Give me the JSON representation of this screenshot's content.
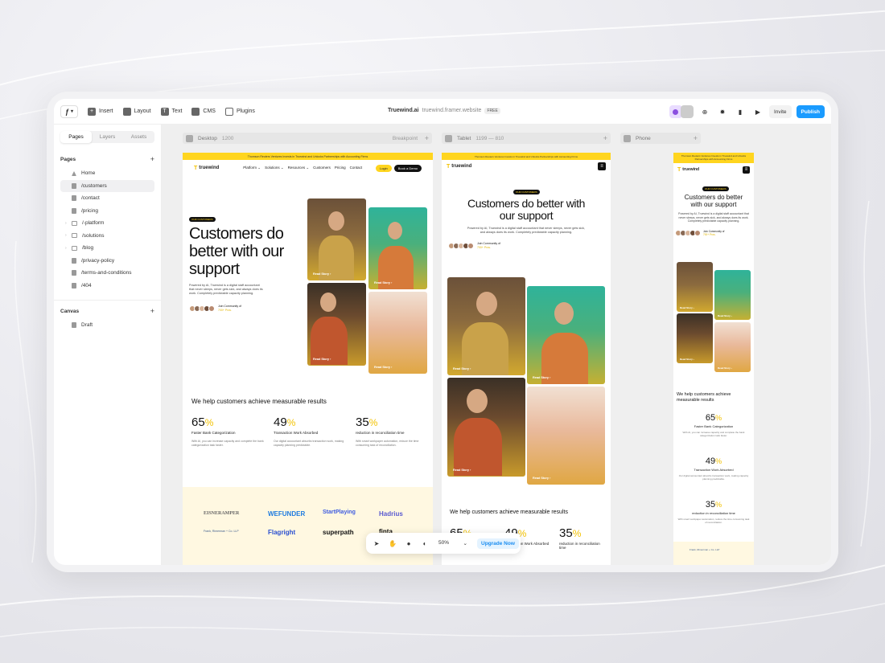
{
  "toolbar": {
    "logo_menu": "▾",
    "insert": "Insert",
    "layout": "Layout",
    "text": "Text",
    "cms": "CMS",
    "plugins": "Plugins",
    "project_name": "Truewind.ai",
    "project_url": "truewind.framer.website",
    "plan_badge": "FREE",
    "invite": "Invite",
    "publish": "Publish",
    "accent_color": "#1a9bff"
  },
  "sidebar": {
    "tabs": [
      "Pages",
      "Layers",
      "Assets"
    ],
    "active_tab": "Pages",
    "pages_heading": "Pages",
    "pages": [
      {
        "label": "Home",
        "icon": "home-icon"
      },
      {
        "label": "/customers",
        "icon": "page-icon",
        "selected": true
      },
      {
        "label": "/contact",
        "icon": "page-icon"
      },
      {
        "label": "/pricing",
        "icon": "page-icon"
      },
      {
        "label": "/-platform",
        "icon": "folder-icon"
      },
      {
        "label": "/solutions",
        "icon": "folder-icon"
      },
      {
        "label": "/blog",
        "icon": "folder-icon"
      },
      {
        "label": "/privacy-policy",
        "icon": "page-icon"
      },
      {
        "label": "/terms-and-conditions",
        "icon": "page-icon"
      },
      {
        "label": "/404",
        "icon": "page-icon"
      }
    ],
    "canvas_heading": "Canvas",
    "canvas_items": [
      {
        "label": "Draft",
        "icon": "page-icon"
      }
    ]
  },
  "viewports": {
    "desktop": {
      "label": "Desktop",
      "size": "1200",
      "breakpoint": "Breakpoint"
    },
    "tablet": {
      "label": "Tablet",
      "size": "1199 — 810"
    },
    "phone": {
      "label": "Phone"
    }
  },
  "site": {
    "banner": "Thomson Reuters Ventures Invests in Truewind and Unlocks Partnerships with Accounting Firms",
    "banner_phone": "Thomson Reuters Ventures Invests in Truewind and Unlocks Partnerships with Accounting Firms",
    "logo": "truewind",
    "nav": [
      "Platform ⌄",
      "Solutions ⌄",
      "Resources ⌄",
      "Customers",
      "Pricing",
      "Contact"
    ],
    "login": "Login",
    "book_demo": "Book a Demo",
    "tag": "OUR CUSTOMERS",
    "heading": "Customers do better with our support",
    "body": "Powered by AI, Truewind is a digital staff accountant that never sleeps, never gets sick, and always does its work. Completely predictable capacity planning.",
    "community_line1": "Join Community of",
    "community_line2": "700+ Pros.",
    "read_story": "Read Story  ›",
    "results_heading": "We help customers achieve measurable results",
    "stats": [
      {
        "value": "65",
        "unit": "%",
        "title": "Faster Bank Categorization",
        "desc": "With AI, you can increase capacity and complete the bank categorization task faster."
      },
      {
        "value": "49",
        "unit": "%",
        "title": "Transaction Work Absorbed",
        "desc": "Our digital accountant absorbs transaction work, making capacity planning predictable."
      },
      {
        "value": "35",
        "unit": "%",
        "title": "reduction in reconciliation time",
        "desc": "With smart workpaper automation, reduce the time consuming task of reconciliation."
      }
    ],
    "logos": [
      "EISNERAMPER",
      "WEFUNDER",
      "StartPlaying",
      "Hadrius",
      "Frank, Rimerman + Co. LLP",
      "Flagright",
      "superpath",
      "finta"
    ],
    "accent_yellow": "#ffd51f"
  },
  "bottom_toolbar": {
    "zoom": "50%",
    "zoom_caret": "⌄",
    "upgrade": "Upgrade Now"
  }
}
